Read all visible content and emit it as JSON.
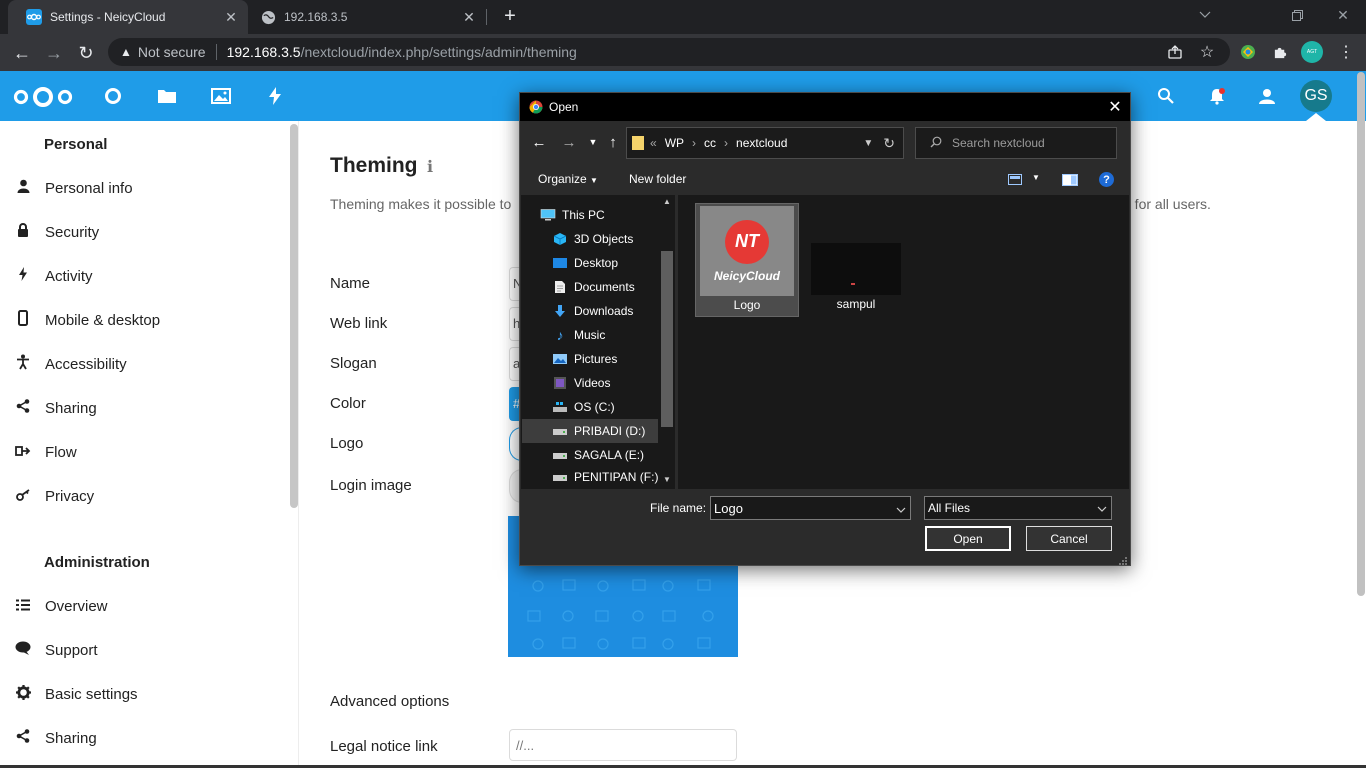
{
  "browser": {
    "tabs": [
      {
        "title": "Settings - NeicyCloud",
        "active": true
      },
      {
        "title": "192.168.3.5",
        "active": false
      }
    ],
    "new_tab": "+",
    "security_label": "Not secure",
    "url_host": "192.168.3.5",
    "url_path": "/nextcloud/index.php/settings/admin/theming",
    "profile_badge": "AGT"
  },
  "header": {
    "avatar_initials": "GS",
    "accent_color": "#1f9ce8"
  },
  "sidebar": {
    "personal_heading": "Personal",
    "personal_items": [
      {
        "label": "Personal info",
        "icon": "person-icon"
      },
      {
        "label": "Security",
        "icon": "lock-icon"
      },
      {
        "label": "Activity",
        "icon": "bolt-icon"
      },
      {
        "label": "Mobile & desktop",
        "icon": "phone-icon"
      },
      {
        "label": "Accessibility",
        "icon": "accessibility-icon"
      },
      {
        "label": "Sharing",
        "icon": "share-icon"
      },
      {
        "label": "Flow",
        "icon": "flow-icon"
      },
      {
        "label": "Privacy",
        "icon": "key-icon"
      }
    ],
    "admin_heading": "Administration",
    "admin_items": [
      {
        "label": "Overview",
        "icon": "list-icon"
      },
      {
        "label": "Support",
        "icon": "chat-icon"
      },
      {
        "label": "Basic settings",
        "icon": "gear-icon"
      },
      {
        "label": "Sharing",
        "icon": "share-icon"
      }
    ]
  },
  "main": {
    "title": "Theming",
    "description_start": "Theming makes it possible to",
    "description_end": "e for all users.",
    "fields": [
      {
        "label": "Name",
        "partial": "N"
      },
      {
        "label": "Web link",
        "partial": "h"
      },
      {
        "label": "Slogan",
        "partial": "a"
      },
      {
        "label": "Color",
        "partial": "#"
      },
      {
        "label": "Logo",
        "partial": ""
      },
      {
        "label": "Login image",
        "partial": ""
      }
    ],
    "advanced_heading": "Advanced options",
    "legal_label": "Legal notice link",
    "legal_placeholder": "//..."
  },
  "dialog": {
    "title": "Open",
    "breadcrumb": [
      "«",
      "WP",
      "›",
      "cc",
      "›",
      "nextcloud"
    ],
    "search_placeholder": "Search nextcloud",
    "organize": "Organize",
    "new_folder": "New folder",
    "help": "?",
    "tree": [
      {
        "label": "This PC",
        "icon": "pc-icon",
        "indent": 0
      },
      {
        "label": "3D Objects",
        "icon": "cube-icon",
        "indent": 1
      },
      {
        "label": "Desktop",
        "icon": "desktop-icon",
        "indent": 1
      },
      {
        "label": "Documents",
        "icon": "document-icon",
        "indent": 1
      },
      {
        "label": "Downloads",
        "icon": "download-icon",
        "indent": 1
      },
      {
        "label": "Music",
        "icon": "music-icon",
        "indent": 1
      },
      {
        "label": "Pictures",
        "icon": "pictures-icon",
        "indent": 1
      },
      {
        "label": "Videos",
        "icon": "video-icon",
        "indent": 1
      },
      {
        "label": "OS (C:)",
        "icon": "drive-icon",
        "indent": 1
      },
      {
        "label": "PRIBADI (D:)",
        "icon": "drive-icon",
        "indent": 1,
        "selected": true
      },
      {
        "label": "SAGALA (E:)",
        "icon": "drive-icon",
        "indent": 1
      },
      {
        "label": "PENITIPAN (F:)",
        "icon": "drive-icon",
        "indent": 1
      }
    ],
    "files": [
      {
        "name": "Logo",
        "selected": true,
        "logo_mark": "NT",
        "logo_text": "NeicyCloud"
      },
      {
        "name": "sampul",
        "selected": false
      }
    ],
    "filename_label": "File name:",
    "filename_value": "Logo",
    "filetype_value": "All Files",
    "open_label": "Open",
    "cancel_label": "Cancel"
  }
}
